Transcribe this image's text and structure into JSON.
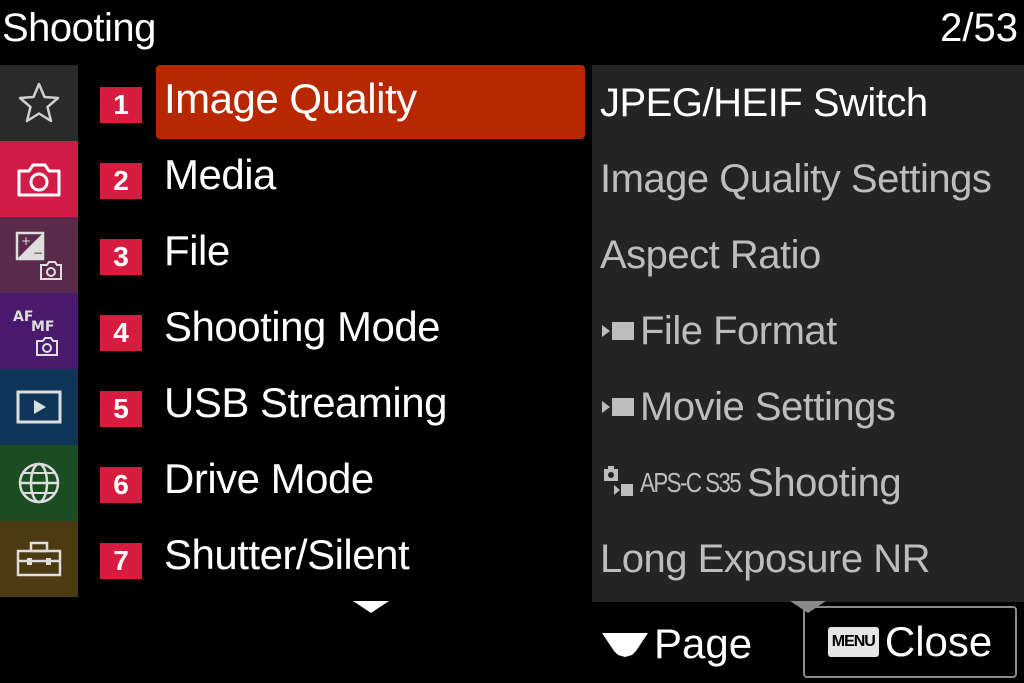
{
  "header": {
    "title": "Shooting",
    "page": "2/53"
  },
  "sidebar": {
    "items": [
      {
        "icon": "star-icon",
        "bg": "#2a2a2a"
      },
      {
        "icon": "camera-icon",
        "bg": "#d01c46"
      },
      {
        "icon": "exposure-camera-icon",
        "bg": "#5a2a4a"
      },
      {
        "icon": "af-mf-icon",
        "af": "AF",
        "mf": "MF",
        "bg": "#4a1a6e"
      },
      {
        "icon": "playback-icon",
        "bg": "#0f3558"
      },
      {
        "icon": "globe-icon",
        "bg": "#1c4c22"
      },
      {
        "icon": "toolbox-icon",
        "bg": "#4c3a12"
      }
    ]
  },
  "menu": {
    "items": [
      {
        "num": "1",
        "label": "Image Quality",
        "selected": true
      },
      {
        "num": "2",
        "label": "Media"
      },
      {
        "num": "3",
        "label": "File"
      },
      {
        "num": "4",
        "label": "Shooting Mode"
      },
      {
        "num": "5",
        "label": "USB Streaming"
      },
      {
        "num": "6",
        "label": "Drive Mode"
      },
      {
        "num": "7",
        "label": "Shutter/Silent"
      }
    ]
  },
  "submenu": {
    "items": [
      {
        "label": "JPEG/HEIF Switch"
      },
      {
        "label": "Image Quality Settings"
      },
      {
        "label": "Aspect Ratio"
      },
      {
        "label": "File Format",
        "icon": "movie-icon"
      },
      {
        "label": "Movie Settings",
        "icon": "movie-icon"
      },
      {
        "label": "Shooting",
        "icon": "photo-movie-icon",
        "prefix": "APS-C S35"
      },
      {
        "label": "Long Exposure NR"
      }
    ]
  },
  "footer": {
    "page_label": "Page",
    "menu_badge": "MENU",
    "close_label": "Close"
  },
  "colors": {
    "accent_red": "#d81c3f",
    "highlight": "#b82800"
  }
}
